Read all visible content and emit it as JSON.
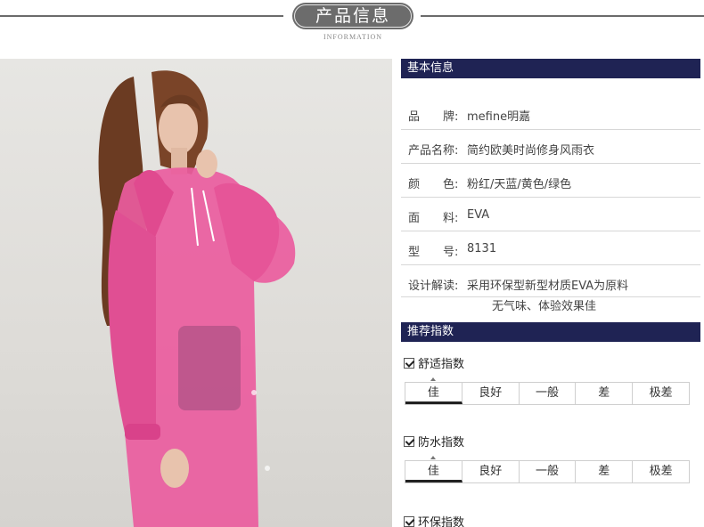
{
  "header": {
    "title": "产品信息",
    "subtitle": "INFORMATION"
  },
  "basic_info": {
    "heading": "基本信息",
    "rows": [
      {
        "label": "品　　牌:",
        "value": "mefine明嘉"
      },
      {
        "label": "产品名称:",
        "value": "简约欧美时尚修身风雨衣"
      },
      {
        "label": "颜　　色:",
        "value": "粉红/天蓝/黄色/绿色"
      },
      {
        "label": "面　　料:",
        "value": "EVA"
      },
      {
        "label": "型　　号:",
        "value": "8131"
      },
      {
        "label": "设计解读:",
        "value": "采用环保型新型材质EVA为原料"
      }
    ],
    "design_note_cont": "无气味、体验效果佳"
  },
  "recommend": {
    "heading": "推荐指数",
    "indices": [
      {
        "name": "舒适指数",
        "options": [
          "佳",
          "良好",
          "一般",
          "差",
          "极差"
        ],
        "selected": "佳"
      },
      {
        "name": "防水指数",
        "options": [
          "佳",
          "良好",
          "一般",
          "差",
          "极差"
        ],
        "selected": "佳"
      },
      {
        "name": "环保指数"
      }
    ]
  },
  "colors": {
    "accent_bar": "#1f2354",
    "raincoat": "#e9559a"
  }
}
